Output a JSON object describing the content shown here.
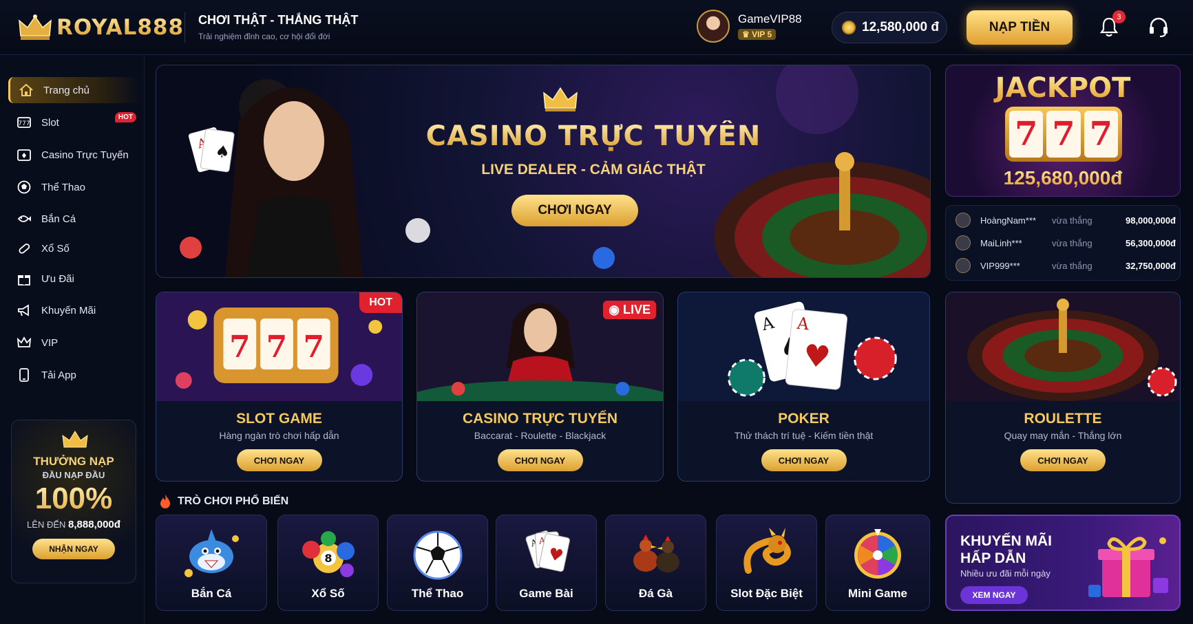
{
  "brand": {
    "logo_text": "ROYAL888",
    "tagline_title": "CHƠI THẬT - THẮNG THẬT",
    "tagline_sub": "Trải nghiệm đỉnh cao, cơ hội đổi đời"
  },
  "user": {
    "name": "GameVIP88",
    "vip": "VIP 5",
    "balance": "12,580,000 đ",
    "deposit_label": "NẠP TIỀN",
    "notification_count": "3"
  },
  "sidebar": {
    "items": [
      {
        "label": "Trang chủ",
        "icon": "home-icon"
      },
      {
        "label": "Slot",
        "icon": "slot-icon",
        "tag": "HOT"
      },
      {
        "label": "Casino Trực Tuyến",
        "icon": "casino-icon"
      },
      {
        "label": "Thể Thao",
        "icon": "football-icon"
      },
      {
        "label": "Bắn Cá",
        "icon": "fish-icon"
      },
      {
        "label": "Xổ Số",
        "icon": "lottery-icon"
      },
      {
        "label": "Ưu Đãi",
        "icon": "gift-icon"
      },
      {
        "label": "Khuyến Mãi",
        "icon": "megaphone-icon"
      },
      {
        "label": "VIP",
        "icon": "crown-icon"
      },
      {
        "label": "Tải App",
        "icon": "phone-icon"
      }
    ],
    "promo": {
      "line1": "THƯỞNG NẠP",
      "line2": "ĐẦU NẠP ĐẦU",
      "percent": "100%",
      "upto_label": "LÊN ĐẾN",
      "upto_value": "8,888,000đ",
      "button": "NHẬN NGAY"
    }
  },
  "hero": {
    "title": "CASINO TRỰC TUYẾN",
    "subtitle": "LIVE DEALER - CẢM GIÁC THẬT",
    "button": "CHƠI NGAY"
  },
  "jackpot": {
    "title": "JACKPOT",
    "reel": "7",
    "value": "125,680,000đ"
  },
  "winners": [
    {
      "name": "HoàngNam***",
      "action": "vừa thắng",
      "amount": "98,000,000đ"
    },
    {
      "name": "MaiLinh***",
      "action": "vừa thắng",
      "amount": "56,300,000đ"
    },
    {
      "name": "VIP999***",
      "action": "vừa thắng",
      "amount": "32,750,000đ"
    }
  ],
  "cards": [
    {
      "title": "SLOT GAME",
      "sub": "Hàng ngàn trò chơi hấp dẫn",
      "button": "CHƠI NGAY",
      "tag": "HOT"
    },
    {
      "title": "CASINO TRỰC TUYẾN",
      "sub": "Baccarat - Roulette - Blackjack",
      "button": "CHƠI NGAY",
      "tag": "LIVE"
    },
    {
      "title": "POKER",
      "sub": "Thử thách trí tuệ - Kiếm tiền thật",
      "button": "CHƠI NGAY"
    },
    {
      "title": "ROULETTE",
      "sub": "Quay may mắn - Thắng lớn",
      "button": "CHƠI NGAY"
    }
  ],
  "popular": {
    "title": "TRÒ CHƠI PHỔ BIẾN",
    "items": [
      {
        "label": "Bắn Cá",
        "icon": "shark-icon"
      },
      {
        "label": "Xổ Số",
        "icon": "lottery-balls-icon"
      },
      {
        "label": "Thể Thao",
        "icon": "soccer-ball-icon"
      },
      {
        "label": "Game Bài",
        "icon": "playing-cards-icon"
      },
      {
        "label": "Đá Gà",
        "icon": "rooster-icon"
      },
      {
        "label": "Slot Đặc Biệt",
        "icon": "dragon-icon"
      },
      {
        "label": "Mini Game",
        "icon": "wheel-icon"
      }
    ]
  },
  "promo_box": {
    "title1": "KHUYẾN MÃI",
    "title2": "HẤP DẪN",
    "sub": "Nhiều ưu đãi mỗi ngày",
    "button": "XEM NGAY"
  },
  "colors": {
    "gold": "#f4c95d",
    "background": "#070b18",
    "hot": "#e0222f",
    "purple": "#6a34d6"
  }
}
